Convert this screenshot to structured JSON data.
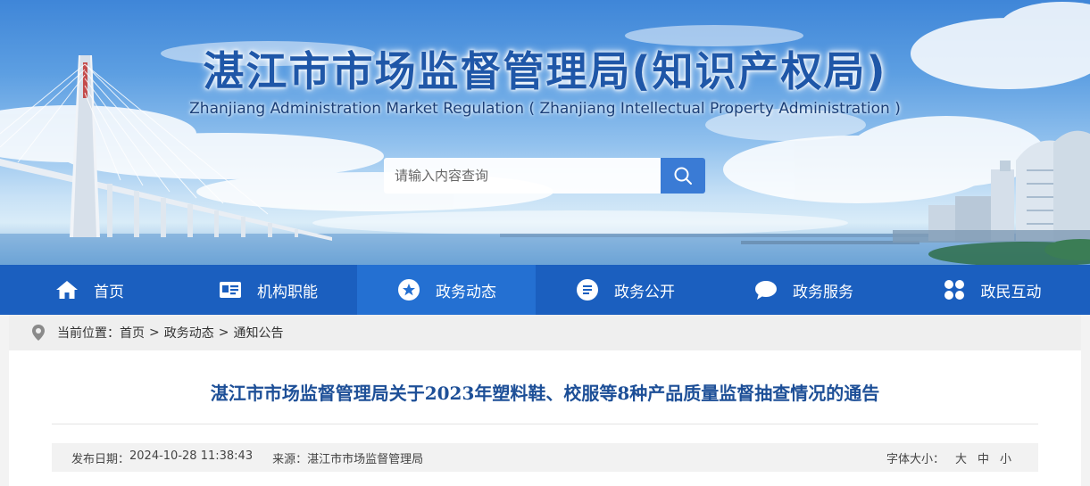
{
  "header": {
    "title": "湛江市市场监督管理局(知识产权局)",
    "subtitle": "Zhanjiang Administration Market Regulation ( Zhanjiang Intellectual Property Administration )"
  },
  "search": {
    "placeholder": "请输入内容查询",
    "icon": "search-icon"
  },
  "nav": {
    "items": [
      {
        "label": "首页",
        "icon": "home-icon"
      },
      {
        "label": "机构职能",
        "icon": "id-card-icon"
      },
      {
        "label": "政务动态",
        "icon": "star-icon",
        "active": true
      },
      {
        "label": "政务公开",
        "icon": "document-icon"
      },
      {
        "label": "政务服务",
        "icon": "chat-bubble-icon"
      },
      {
        "label": "政民互动",
        "icon": "grid-icon"
      }
    ]
  },
  "breadcrumb": {
    "prefix": "当前位置：",
    "items": [
      "首页",
      "政务动态",
      "通知公告"
    ],
    "separator": ">"
  },
  "article": {
    "title": "湛江市市场监督管理局关于2023年塑料鞋、校服等8种产品质量监督抽查情况的通告",
    "date_label": "发布日期：",
    "date": "2024-10-28 11:38:43",
    "source_label": "来源：",
    "source": "湛江市市场监督管理局",
    "font_size_label": "字体大小：",
    "font_sizes": [
      "大",
      "中",
      "小"
    ]
  },
  "colors": {
    "nav_bg": "#1b5fbf",
    "nav_active": "#2470d2",
    "title_blue": "#1f57a8",
    "article_title": "#1d4f97",
    "search_button": "#3a7bd5"
  }
}
